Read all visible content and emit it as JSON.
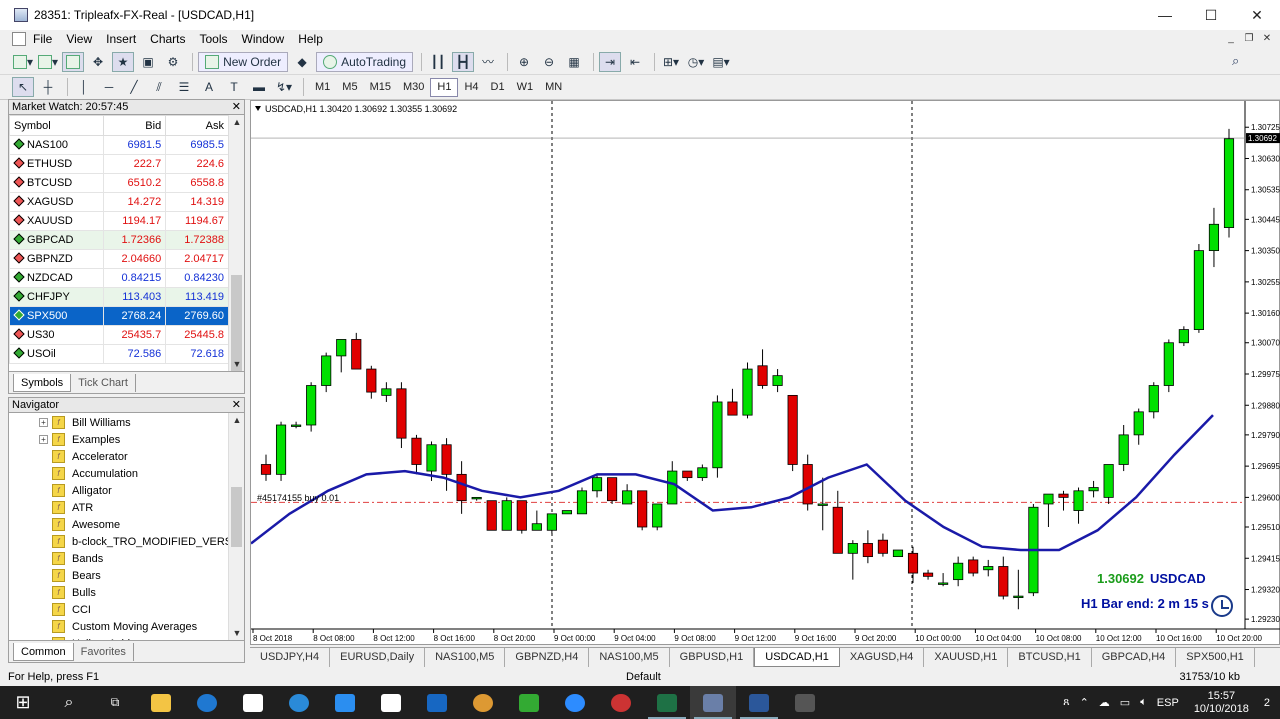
{
  "window": {
    "title": "28351: Tripleafx-FX-Real - [USDCAD,H1]"
  },
  "menu": [
    "File",
    "View",
    "Insert",
    "Charts",
    "Tools",
    "Window",
    "Help"
  ],
  "toolbar": {
    "new_order": "New Order",
    "autotrading": "AutoTrading",
    "font_a": "A",
    "timeframes": [
      "M1",
      "M5",
      "M15",
      "M30",
      "H1",
      "H4",
      "D1",
      "W1",
      "MN"
    ],
    "selected_tf": "H1"
  },
  "market_watch": {
    "title": "Market Watch: 20:57:45",
    "columns": [
      "Symbol",
      "Bid",
      "Ask"
    ],
    "rows": [
      {
        "symbol": "NAS100",
        "bid": "6981.5",
        "ask": "6985.5",
        "dir": "up",
        "color": "blue"
      },
      {
        "symbol": "ETHUSD",
        "bid": "222.7",
        "ask": "224.6",
        "dir": "dn",
        "color": "red"
      },
      {
        "symbol": "BTCUSD",
        "bid": "6510.2",
        "ask": "6558.8",
        "dir": "dn",
        "color": "red"
      },
      {
        "symbol": "XAGUSD",
        "bid": "14.272",
        "ask": "14.319",
        "dir": "dn",
        "color": "red"
      },
      {
        "symbol": "XAUUSD",
        "bid": "1194.17",
        "ask": "1194.67",
        "dir": "dn",
        "color": "red"
      },
      {
        "symbol": "GBPCAD",
        "bid": "1.72366",
        "ask": "1.72388",
        "dir": "up",
        "color": "red",
        "hl": true
      },
      {
        "symbol": "GBPNZD",
        "bid": "2.04660",
        "ask": "2.04717",
        "dir": "dn",
        "color": "red"
      },
      {
        "symbol": "NZDCAD",
        "bid": "0.84215",
        "ask": "0.84230",
        "dir": "up",
        "color": "blue"
      },
      {
        "symbol": "CHFJPY",
        "bid": "113.403",
        "ask": "113.419",
        "dir": "up",
        "color": "blue",
        "hl": true
      },
      {
        "symbol": "SPX500",
        "bid": "2768.24",
        "ask": "2769.60",
        "dir": "up",
        "color": "blue",
        "selected": true
      },
      {
        "symbol": "US30",
        "bid": "25435.7",
        "ask": "25445.8",
        "dir": "dn",
        "color": "red"
      },
      {
        "symbol": "USOil",
        "bid": "72.586",
        "ask": "72.618",
        "dir": "up",
        "color": "blue"
      }
    ],
    "tabs": [
      "Symbols",
      "Tick Chart"
    ]
  },
  "navigator": {
    "title": "Navigator",
    "items": [
      {
        "label": "Bill Williams",
        "folder": true
      },
      {
        "label": "Examples",
        "folder": true
      },
      {
        "label": "Accelerator"
      },
      {
        "label": "Accumulation"
      },
      {
        "label": "Alligator"
      },
      {
        "label": "ATR"
      },
      {
        "label": "Awesome"
      },
      {
        "label": "b-clock_TRO_MODIFIED_VERSI"
      },
      {
        "label": "Bands"
      },
      {
        "label": "Bears"
      },
      {
        "label": "Bulls"
      },
      {
        "label": "CCI"
      },
      {
        "label": "Custom Moving Averages"
      },
      {
        "label": "Heiken Ashi"
      }
    ],
    "tabs": [
      "Common",
      "Favorites"
    ]
  },
  "chart": {
    "info": "USDCAD,H1  1.30420 1.30692 1.30355 1.30692",
    "order_label": "#45174155 buy 0.01",
    "last_price": "1.30692",
    "symbol": "USDCAD",
    "bar_end": "H1 Bar end: 2 m 15 s",
    "colors": {
      "bull": "#00e000",
      "bear": "#e00000",
      "ma": "#1a1aa8",
      "order": "#e04040"
    }
  },
  "chart_data": {
    "type": "candlestick",
    "symbol": "USDCAD",
    "timeframe": "H1",
    "ylim": [
      1.292,
      1.3075
    ],
    "y_ticks": [
      "1.30725",
      "1.30630",
      "1.30535",
      "1.30445",
      "1.30350",
      "1.30255",
      "1.30160",
      "1.30070",
      "1.29975",
      "1.29880",
      "1.29790",
      "1.29695",
      "1.29600",
      "1.29510",
      "1.29415",
      "1.29320",
      "1.29230"
    ],
    "current_price": "1.30692",
    "order_price": 1.29585,
    "x_labels": [
      "8 Oct 2018",
      "8 Oct 08:00",
      "8 Oct 12:00",
      "8 Oct 16:00",
      "8 Oct 20:00",
      "9 Oct 00:00",
      "9 Oct 04:00",
      "9 Oct 08:00",
      "9 Oct 12:00",
      "9 Oct 16:00",
      "9 Oct 20:00",
      "10 Oct 00:00",
      "10 Oct 04:00",
      "10 Oct 08:00",
      "10 Oct 12:00",
      "10 Oct 16:00",
      "10 Oct 20:00"
    ],
    "candles": [
      [
        1.297,
        1.2973,
        1.2965,
        1.2967
      ],
      [
        1.2967,
        1.2983,
        1.2965,
        1.2982
      ],
      [
        1.2982,
        1.2983,
        1.2981,
        1.2982
      ],
      [
        1.2982,
        1.2995,
        1.298,
        1.2994
      ],
      [
        1.2994,
        1.3004,
        1.2992,
        1.3003
      ],
      [
        1.3003,
        1.3008,
        1.2998,
        1.3008
      ],
      [
        1.3008,
        1.301,
        1.2999,
        1.2999
      ],
      [
        1.2999,
        1.3,
        1.299,
        1.2992
      ],
      [
        1.2991,
        1.2995,
        1.2989,
        1.2993
      ],
      [
        1.2993,
        1.2995,
        1.2975,
        1.2978
      ],
      [
        1.2978,
        1.2979,
        1.2967,
        1.297
      ],
      [
        1.2968,
        1.2977,
        1.2965,
        1.2976
      ],
      [
        1.2976,
        1.2978,
        1.2962,
        1.2967
      ],
      [
        1.2967,
        1.2971,
        1.2955,
        1.2959
      ],
      [
        1.296,
        1.296,
        1.2959,
        1.296
      ],
      [
        1.2959,
        1.2959,
        1.295,
        1.295
      ],
      [
        1.295,
        1.296,
        1.295,
        1.2959
      ],
      [
        1.2959,
        1.2959,
        1.2949,
        1.295
      ],
      [
        1.295,
        1.2956,
        1.295,
        1.2952
      ],
      [
        1.295,
        1.2955,
        1.2949,
        1.2955
      ],
      [
        1.2955,
        1.2956,
        1.2955,
        1.2956
      ],
      [
        1.2955,
        1.2963,
        1.2955,
        1.2962
      ],
      [
        1.2962,
        1.2967,
        1.296,
        1.2966
      ],
      [
        1.2966,
        1.2966,
        1.2958,
        1.2959
      ],
      [
        1.2958,
        1.2964,
        1.2958,
        1.2962
      ],
      [
        1.2962,
        1.2962,
        1.295,
        1.2951
      ],
      [
        1.2951,
        1.2958,
        1.295,
        1.2958
      ],
      [
        1.2958,
        1.2971,
        1.2958,
        1.2968
      ],
      [
        1.2968,
        1.2968,
        1.2965,
        1.2966
      ],
      [
        1.2966,
        1.297,
        1.2965,
        1.2969
      ],
      [
        1.2969,
        1.2991,
        1.2966,
        1.2989
      ],
      [
        1.2989,
        1.2993,
        1.2985,
        1.2985
      ],
      [
        1.2985,
        1.3001,
        1.2984,
        1.2999
      ],
      [
        1.3,
        1.3005,
        1.2993,
        1.2994
      ],
      [
        1.2994,
        1.2999,
        1.2992,
        1.2997
      ],
      [
        1.2991,
        1.2991,
        1.2968,
        1.297
      ],
      [
        1.297,
        1.2973,
        1.2956,
        1.2958
      ],
      [
        1.2958,
        1.2966,
        1.295,
        1.2958
      ],
      [
        1.2957,
        1.2962,
        1.2944,
        1.2943
      ],
      [
        1.2943,
        1.2947,
        1.2935,
        1.2946
      ],
      [
        1.2946,
        1.295,
        1.294,
        1.2942
      ],
      [
        1.2947,
        1.2949,
        1.2942,
        1.2943
      ],
      [
        1.2942,
        1.2944,
        1.2942,
        1.2944
      ],
      [
        1.2943,
        1.2945,
        1.2934,
        1.2937
      ],
      [
        1.2937,
        1.2938,
        1.2935,
        1.2936
      ],
      [
        1.2934,
        1.2937,
        1.2933,
        1.2934
      ],
      [
        1.2935,
        1.2942,
        1.2933,
        1.294
      ],
      [
        1.2941,
        1.2942,
        1.2936,
        1.2937
      ],
      [
        1.2938,
        1.2941,
        1.2936,
        1.2939
      ],
      [
        1.2939,
        1.2942,
        1.2929,
        1.293
      ],
      [
        1.293,
        1.2938,
        1.2926,
        1.293
      ],
      [
        1.2931,
        1.2958,
        1.293,
        1.2957
      ],
      [
        1.2958,
        1.2961,
        1.2951,
        1.2961
      ],
      [
        1.2961,
        1.2962,
        1.2956,
        1.296
      ],
      [
        1.2956,
        1.2963,
        1.2952,
        1.2962
      ],
      [
        1.2962,
        1.2965,
        1.296,
        1.2963
      ],
      [
        1.296,
        1.2967,
        1.2958,
        1.297
      ],
      [
        1.297,
        1.2982,
        1.2968,
        1.2979
      ],
      [
        1.2979,
        1.2987,
        1.2976,
        1.2986
      ],
      [
        1.2986,
        1.2995,
        1.2984,
        1.2994
      ],
      [
        1.2994,
        1.3008,
        1.2992,
        1.3007
      ],
      [
        1.3007,
        1.3012,
        1.3006,
        1.3011
      ],
      [
        1.3011,
        1.3037,
        1.301,
        1.3035
      ],
      [
        1.3035,
        1.3048,
        1.303,
        1.3043
      ],
      [
        1.3042,
        1.3072,
        1.3039,
        1.3069
      ]
    ],
    "ma": [
      1.2946,
      1.2955,
      1.2962,
      1.2967,
      1.2968,
      1.2966,
      1.2962,
      1.296,
      1.2962,
      1.2967,
      1.2967,
      1.2964,
      1.2956,
      1.2957,
      1.296,
      1.2966,
      1.297,
      1.2959,
      1.2951,
      1.2945,
      1.2944,
      1.2944,
      1.295,
      1.296,
      1.2973,
      1.2985
    ]
  },
  "chart_tabs": [
    "USDJPY,H4",
    "EURUSD,Daily",
    "NAS100,M5",
    "GBPNZD,H4",
    "NAS100,M5",
    "GBPUSD,H1",
    "USDCAD,H1",
    "XAGUSD,H4",
    "XAUUSD,H1",
    "BTCUSD,H1",
    "GBPCAD,H4",
    "SPX500,H1"
  ],
  "active_chart_tab": "USDCAD,H1",
  "statusbar": {
    "help": "For Help, press F1",
    "profile": "Default",
    "traffic": "31753/10 kb"
  },
  "taskbar": {
    "lang": "ESP",
    "time": "15:57",
    "date": "10/10/2018",
    "notif": "2"
  }
}
